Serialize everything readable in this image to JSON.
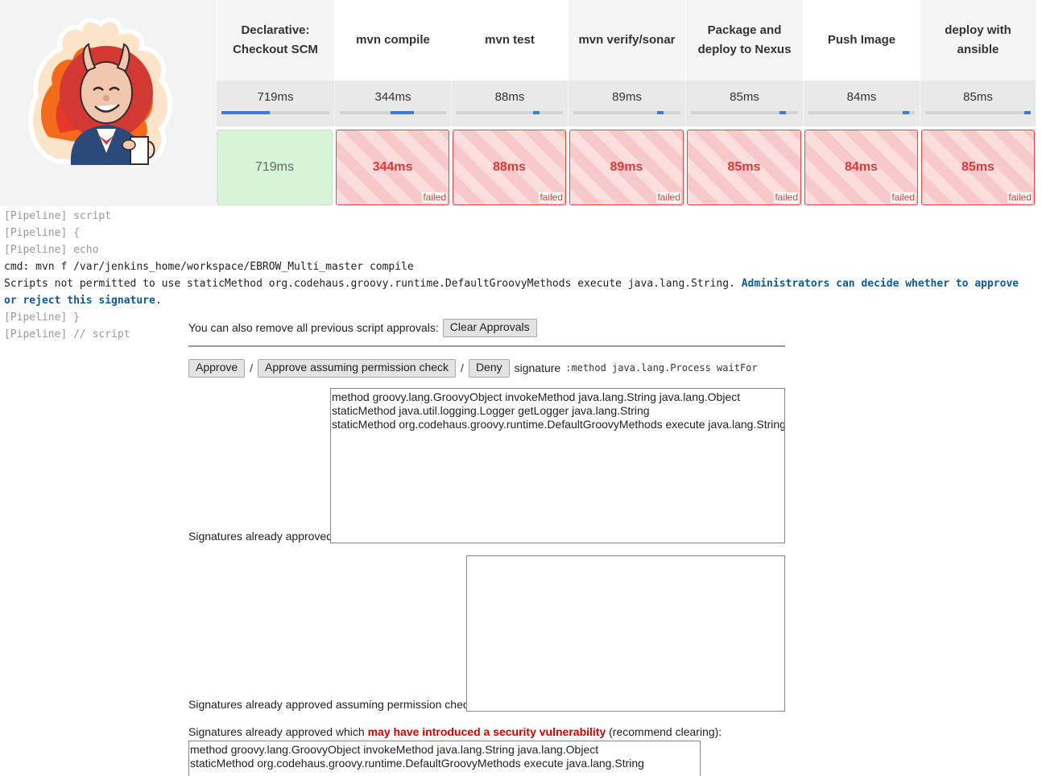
{
  "stages": [
    {
      "name": "Declarative: Checkout SCM",
      "duration": "719ms",
      "cell": "719ms",
      "status": "success",
      "bar_fill": 0.45,
      "bar_offset": 0.0
    },
    {
      "name": "mvn compile",
      "duration": "344ms",
      "cell": "344ms",
      "status": "failed",
      "bar_fill": 0.22,
      "bar_offset": 0.48
    },
    {
      "name": "mvn test",
      "duration": "88ms",
      "cell": "88ms",
      "status": "failed",
      "bar_fill": 0.06,
      "bar_offset": 0.72
    },
    {
      "name": "mvn verify/sonar",
      "duration": "89ms",
      "cell": "89ms",
      "status": "failed",
      "bar_fill": 0.06,
      "bar_offset": 0.78
    },
    {
      "name": "Package and deploy to Nexus",
      "duration": "85ms",
      "cell": "85ms",
      "status": "failed",
      "bar_fill": 0.06,
      "bar_offset": 0.83
    },
    {
      "name": "Push Image",
      "duration": "84ms",
      "cell": "84ms",
      "status": "failed",
      "bar_fill": 0.06,
      "bar_offset": 0.89
    },
    {
      "name": "deploy with ansible",
      "duration": "85ms",
      "cell": "85ms",
      "status": "failed",
      "bar_fill": 0.06,
      "bar_offset": 0.94
    }
  ],
  "failed_label": "failed",
  "console": {
    "lines": [
      "[Pipeline] script",
      "[Pipeline] {",
      "[Pipeline] echo"
    ],
    "cmd_line": "cmd: mvn   f /var/jenkins_home/workspace/EBROW_Multi_master compile",
    "error_text": "Scripts not permitted to use staticMethod org.codehaus.groovy.runtime.DefaultGroovyMethods execute java.lang.String.",
    "error_link": "Administrators can decide whether to approve or reject this signature",
    "error_end": ".",
    "tail_lines": [
      "[Pipeline] }",
      "[Pipeline] // script"
    ]
  },
  "approval": {
    "remove_text": "You can also remove all previous script approvals:",
    "clear_button": "Clear Approvals",
    "approve_button": "Approve",
    "approve_assuming_button": "Approve assuming permission check",
    "deny_button": "Deny",
    "separator": "/",
    "signature_label": "signature",
    "signature_value": ":method java.lang.Process waitFor",
    "approved_label": "Signatures already approved:",
    "approved_lines": "method groovy.lang.GroovyObject invokeMethod java.lang.String java.lang.Object\nstaticMethod java.util.logging.Logger getLogger java.lang.String\nstaticMethod org.codehaus.groovy.runtime.DefaultGroovyMethods execute java.lang.String",
    "approved_assuming_label": "Signatures already approved assuming permission check:",
    "approved_assuming_lines": "",
    "vuln_prefix": "Signatures already approved which ",
    "vuln_highlight": "may have introduced a security vulnerability",
    "vuln_suffix": " (recommend clearing):",
    "vuln_lines": "method groovy.lang.GroovyObject invokeMethod java.lang.String java.lang.Object\nstaticMethod org.codehaus.groovy.runtime.DefaultGroovyMethods execute java.lang.String"
  },
  "colors": {
    "success_cell": "#d6f5d6",
    "failed_text": "#d93a3a",
    "progress_bar": "#3d7bd6",
    "link": "#0a5a9c",
    "warning": "#d40000"
  },
  "logo_icon": "jenkins-devil-logo"
}
